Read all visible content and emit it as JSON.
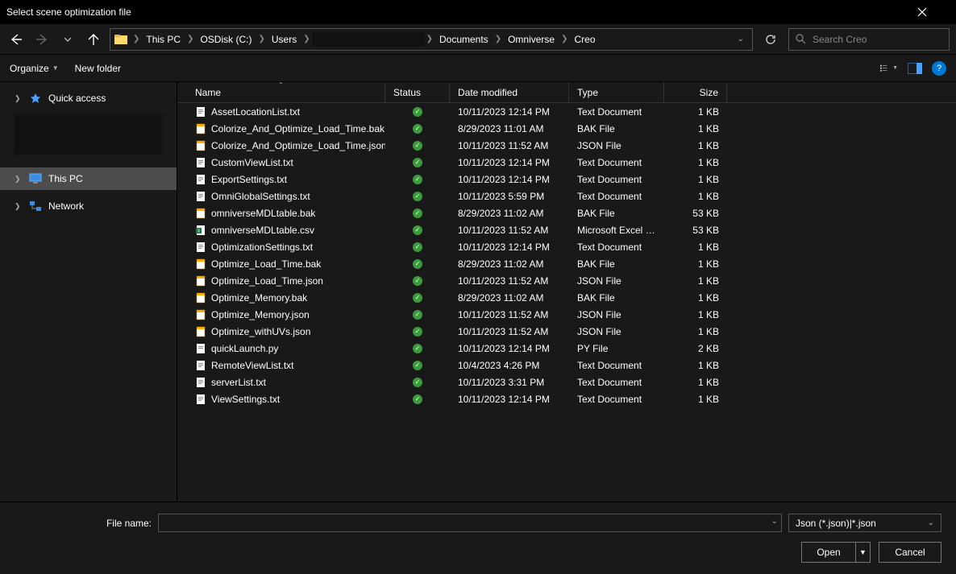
{
  "title": "Select scene optimization file",
  "breadcrumb": [
    "This PC",
    "OSDisk (C:)",
    "Users",
    "",
    "Documents",
    "Omniverse",
    "Creo"
  ],
  "search_placeholder": "Search Creo",
  "toolbar": {
    "organize": "Organize",
    "new_folder": "New folder"
  },
  "sidebar": {
    "quick_access": "Quick access",
    "this_pc": "This PC",
    "network": "Network"
  },
  "columns": {
    "name": "Name",
    "status": "Status",
    "date": "Date modified",
    "type": "Type",
    "size": "Size"
  },
  "files": [
    {
      "icon": "txt",
      "name": "AssetLocationList.txt",
      "date": "10/11/2023 12:14 PM",
      "type": "Text Document",
      "size": "1 KB"
    },
    {
      "icon": "bak",
      "name": "Colorize_And_Optimize_Load_Time.bak",
      "date": "8/29/2023 11:01 AM",
      "type": "BAK File",
      "size": "1 KB"
    },
    {
      "icon": "json",
      "name": "Colorize_And_Optimize_Load_Time.json",
      "date": "10/11/2023 11:52 AM",
      "type": "JSON File",
      "size": "1 KB"
    },
    {
      "icon": "txt",
      "name": "CustomViewList.txt",
      "date": "10/11/2023 12:14 PM",
      "type": "Text Document",
      "size": "1 KB"
    },
    {
      "icon": "txt",
      "name": "ExportSettings.txt",
      "date": "10/11/2023 12:14 PM",
      "type": "Text Document",
      "size": "1 KB"
    },
    {
      "icon": "txt",
      "name": "OmniGlobalSettings.txt",
      "date": "10/11/2023 5:59 PM",
      "type": "Text Document",
      "size": "1 KB"
    },
    {
      "icon": "bak",
      "name": "omniverseMDLtable.bak",
      "date": "8/29/2023 11:02 AM",
      "type": "BAK File",
      "size": "53 KB"
    },
    {
      "icon": "csv",
      "name": "omniverseMDLtable.csv",
      "date": "10/11/2023 11:52 AM",
      "type": "Microsoft Excel C...",
      "size": "53 KB"
    },
    {
      "icon": "txt",
      "name": "OptimizationSettings.txt",
      "date": "10/11/2023 12:14 PM",
      "type": "Text Document",
      "size": "1 KB"
    },
    {
      "icon": "bak",
      "name": "Optimize_Load_Time.bak",
      "date": "8/29/2023 11:02 AM",
      "type": "BAK File",
      "size": "1 KB"
    },
    {
      "icon": "json",
      "name": "Optimize_Load_Time.json",
      "date": "10/11/2023 11:52 AM",
      "type": "JSON File",
      "size": "1 KB"
    },
    {
      "icon": "bak",
      "name": "Optimize_Memory.bak",
      "date": "8/29/2023 11:02 AM",
      "type": "BAK File",
      "size": "1 KB"
    },
    {
      "icon": "json",
      "name": "Optimize_Memory.json",
      "date": "10/11/2023 11:52 AM",
      "type": "JSON File",
      "size": "1 KB"
    },
    {
      "icon": "json",
      "name": "Optimize_withUVs.json",
      "date": "10/11/2023 11:52 AM",
      "type": "JSON File",
      "size": "1 KB"
    },
    {
      "icon": "py",
      "name": "quickLaunch.py",
      "date": "10/11/2023 12:14 PM",
      "type": "PY File",
      "size": "2 KB"
    },
    {
      "icon": "txt",
      "name": "RemoteViewList.txt",
      "date": "10/4/2023 4:26 PM",
      "type": "Text Document",
      "size": "1 KB"
    },
    {
      "icon": "txt",
      "name": "serverList.txt",
      "date": "10/11/2023 3:31 PM",
      "type": "Text Document",
      "size": "1 KB"
    },
    {
      "icon": "txt",
      "name": "ViewSettings.txt",
      "date": "10/11/2023 12:14 PM",
      "type": "Text Document",
      "size": "1 KB"
    }
  ],
  "footer": {
    "filename_label": "File name:",
    "filter": "Json (*.json)|*.json",
    "open": "Open",
    "cancel": "Cancel"
  }
}
